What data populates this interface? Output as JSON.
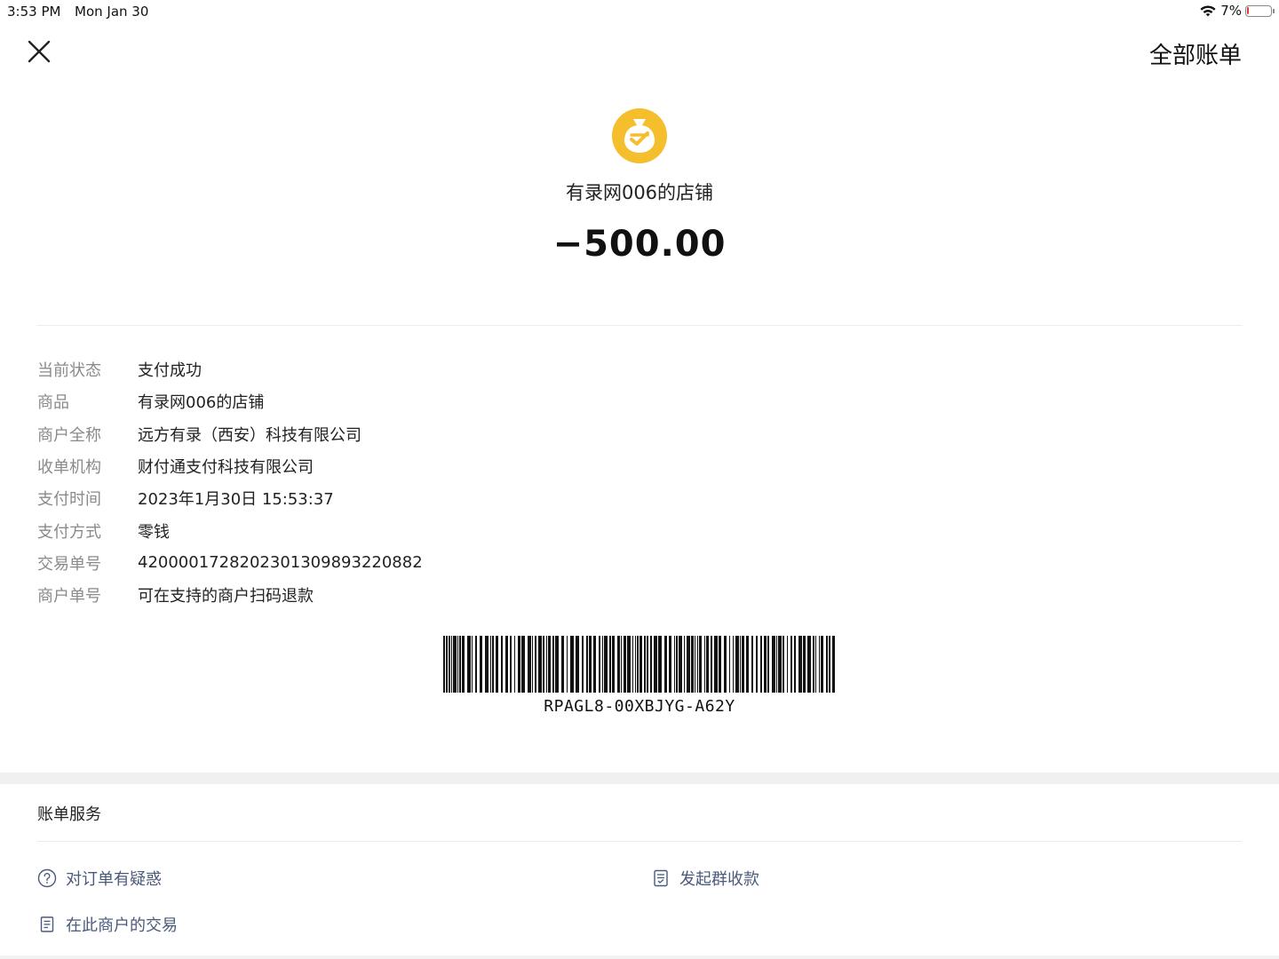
{
  "status_bar": {
    "time": "3:53 PM",
    "date": "Mon Jan 30",
    "battery_percent": "7%",
    "battery_level": 0.07,
    "battery_color": "#e53935"
  },
  "header": {
    "close_icon": "close-icon",
    "all_bills_label": "全部账单"
  },
  "merchant": {
    "logo_icon": "merchant-bag-icon",
    "logo_color": "#f5be2c",
    "name": "有录网006的店铺"
  },
  "amount": "−500.00",
  "details": [
    {
      "label": "当前状态",
      "value": "支付成功"
    },
    {
      "label": "商品",
      "value": "有录网006的店铺"
    },
    {
      "label": "商户全称",
      "value": "远方有录（西安）科技有限公司"
    },
    {
      "label": "收单机构",
      "value": "财付通支付科技有限公司"
    },
    {
      "label": "支付时间",
      "value": "2023年1月30日 15:53:37"
    },
    {
      "label": "支付方式",
      "value": "零钱"
    },
    {
      "label": "交易单号",
      "value": "4200001728202301309893220882"
    },
    {
      "label": "商户单号",
      "value": "可在支持的商户扫码退款"
    }
  ],
  "barcode": {
    "text": "RPAGL8-00XBJYG-A62Y"
  },
  "services": {
    "title": "账单服务",
    "items": [
      {
        "label": "对订单有疑惑",
        "icon": "question-circle-icon"
      },
      {
        "label": "发起群收款",
        "icon": "group-receipt-icon"
      },
      {
        "label": "在此商户的交易",
        "icon": "document-icon"
      }
    ],
    "link_color": "#4a5a7a"
  }
}
